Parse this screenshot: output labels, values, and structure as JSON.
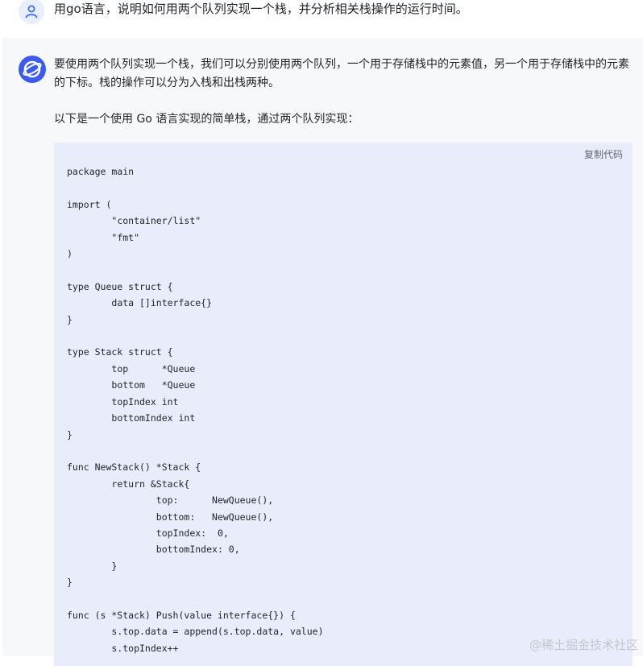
{
  "user_message": {
    "text": "用go语言，说明如何用两个队列实现一个栈，并分析相关栈操作的运行时间。"
  },
  "ai_message": {
    "paragraphs": [
      "要使用两个队列实现一个栈，我们可以分别使用两个队列，一个用于存储栈中的元素值，另一个用于存储栈中的元素的下标。栈的操作可以分为入栈和出栈两种。",
      "以下是一个使用 Go 语言实现的简单栈，通过两个队列实现："
    ],
    "code_block": {
      "copy_label": "复制代码",
      "code": "package main\n\nimport (\n\t\"container/list\"\n\t\"fmt\"\n)\n\ntype Queue struct {\n\tdata []interface{}\n}\n\ntype Stack struct {\n\ttop      *Queue\n\tbottom   *Queue\n\ttopIndex int\n\tbottomIndex int\n}\n\nfunc NewStack() *Stack {\n\treturn &Stack{\n\t\ttop:      NewQueue(),\n\t\tbottom:   NewQueue(),\n\t\ttopIndex:  0,\n\t\tbottomIndex: 0,\n\t}\n}\n\nfunc (s *Stack) Push(value interface{}) {\n\ts.top.data = append(s.top.data, value)\n\ts.topIndex++"
    }
  },
  "watermark": "@稀土掘金技术社区",
  "colors": {
    "user_avatar_bg": "#e8eefc",
    "user_avatar_fg": "#3b6cf6",
    "ai_avatar_bg": "#3b5bf0",
    "code_bg": "#e9ecfb"
  }
}
